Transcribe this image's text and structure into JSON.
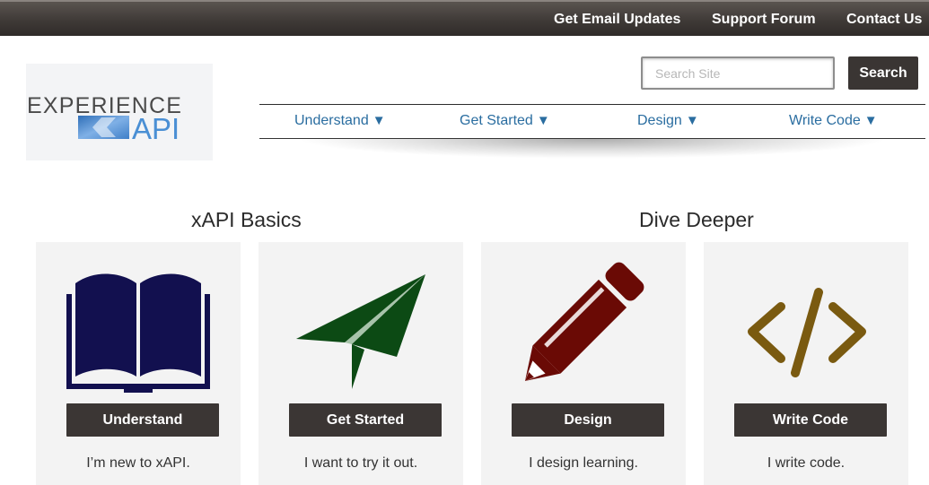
{
  "topbar": {
    "links": [
      "Get Email Updates",
      "Support Forum",
      "Contact Us"
    ]
  },
  "logo": {
    "line1": "EXPERIENCE",
    "line2": "API",
    "colors": {
      "text": "#4a4a4a",
      "accent": "#4a8fd4"
    }
  },
  "search": {
    "placeholder": "Search Site",
    "value": "",
    "button_label": "Search"
  },
  "nav": {
    "items": [
      {
        "label": "Understand",
        "icon": "caret-down-icon"
      },
      {
        "label": "Get Started",
        "icon": "caret-down-icon"
      },
      {
        "label": "Design",
        "icon": "caret-down-icon"
      },
      {
        "label": "Write Code",
        "icon": "caret-down-icon"
      }
    ],
    "color": "#2a6da0"
  },
  "sections": {
    "basics_title": "xAPI Basics",
    "deeper_title": "Dive Deeper"
  },
  "cards": [
    {
      "icon": "book-icon",
      "icon_color": "#12104f",
      "button": "Understand",
      "caption": "I’m new to xAPI."
    },
    {
      "icon": "paper-plane-icon",
      "icon_color": "#0c4a14",
      "button": "Get Started",
      "caption": "I want to try it out."
    },
    {
      "icon": "pencil-icon",
      "icon_color": "#6a0a05",
      "button": "Design",
      "caption": "I design learning."
    },
    {
      "icon": "code-icon",
      "icon_color": "#7a5a10",
      "button": "Write Code",
      "caption": "I write code."
    }
  ]
}
